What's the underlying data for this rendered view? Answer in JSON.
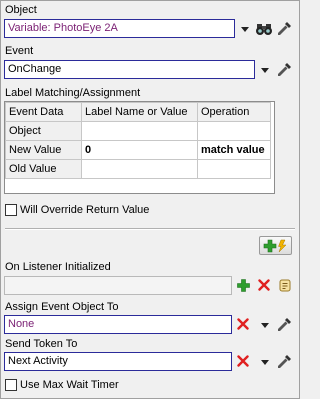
{
  "object": {
    "label": "Object",
    "value": "Variable: PhotoEye 2A"
  },
  "event": {
    "label": "Event",
    "value": "OnChange"
  },
  "matching": {
    "label": "Label Matching/Assignment",
    "headers": [
      "Event Data",
      "Label Name or Value",
      "Operation"
    ],
    "rows": [
      {
        "name": "Object",
        "value": "",
        "op": ""
      },
      {
        "name": "New Value",
        "value": "0",
        "op": "match value"
      },
      {
        "name": "Old Value",
        "value": "",
        "op": ""
      }
    ]
  },
  "override": {
    "label": "Will Override Return Value",
    "checked": false
  },
  "listener": {
    "label": "On Listener Initialized",
    "value": ""
  },
  "assign": {
    "label": "Assign Event Object To",
    "value": "None"
  },
  "token": {
    "label": "Send Token To",
    "value": "Next Activity"
  },
  "maxwait": {
    "label": "Use Max Wait Timer",
    "checked": false
  },
  "colors": {
    "field_border": "#2b2b9a",
    "value_text": "#7a1f73",
    "delete_red": "#e02020",
    "add_green": "#2e9e2e"
  }
}
